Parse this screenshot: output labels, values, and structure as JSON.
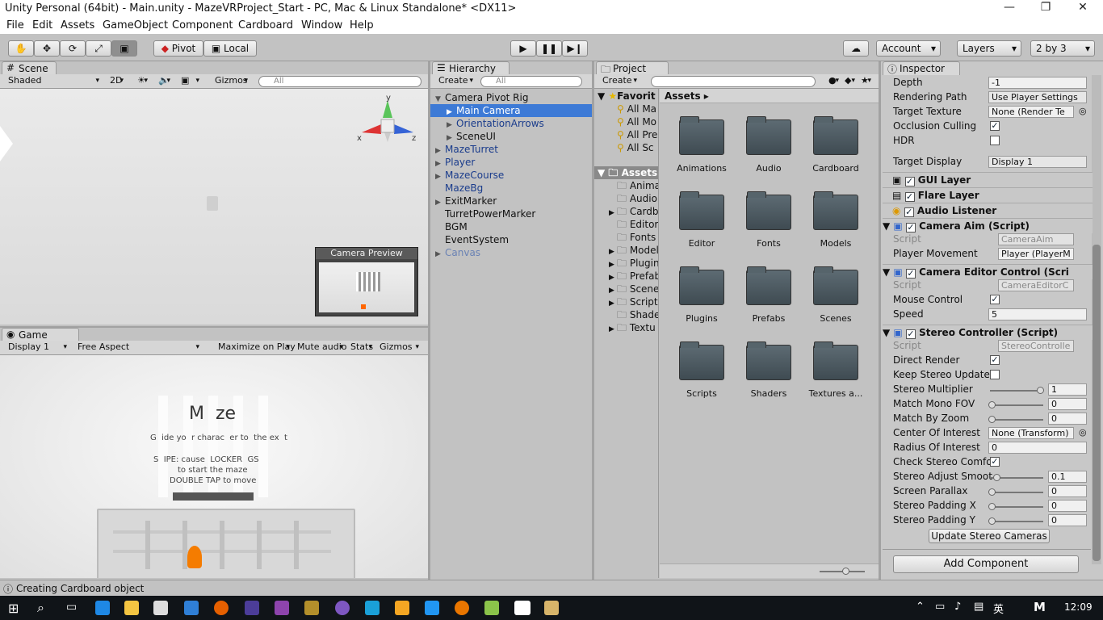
{
  "window": {
    "title": "Unity Personal (64bit) - Main.unity - MazeVRProject_Start - PC, Mac & Linux Standalone* <DX11>",
    "minimize": "—",
    "restore": "❐",
    "close": "✕"
  },
  "menu": [
    "File",
    "Edit",
    "Assets",
    "GameObject",
    "Component",
    "Cardboard",
    "Window",
    "Help"
  ],
  "toolbar": {
    "pivot": "Pivot",
    "local": "Local",
    "account": "Account",
    "layers": "Layers",
    "layout": "2 by 3"
  },
  "scene": {
    "tab": "Scene",
    "shading": "Shaded",
    "mode2d": "2D",
    "gizmos": "Gizmos",
    "search": "All",
    "axis_x": "x",
    "axis_y": "y",
    "axis_z": "z",
    "preview_title": "Camera Preview"
  },
  "game": {
    "tab": "Game",
    "display": "Display 1",
    "aspect": "Free Aspect",
    "maximize": "Maximize on Play",
    "mute": "Mute audio",
    "stats": "Stats",
    "gizmos": "Gizmos",
    "logo": "M  ze",
    "line1": "G  ide yo  r charac  er to  the ex  t",
    "line2": "S  IPE: cause  LOCKER  GS",
    "line3": "to start the maze",
    "line4": "DOUBLE TAP to move"
  },
  "hierarchy": {
    "tab": "Hierarchy",
    "create": "Create",
    "search": "All",
    "items": [
      {
        "label": "Camera Pivot Rig",
        "indent": 0,
        "arrow": "▼",
        "color": "black",
        "selected": false
      },
      {
        "label": "Main Camera",
        "indent": 1,
        "arrow": "▶",
        "color": "white",
        "selected": true
      },
      {
        "label": "OrientationArrows",
        "indent": 1,
        "arrow": "▶",
        "color": "blue",
        "selected": false
      },
      {
        "label": "SceneUI",
        "indent": 1,
        "arrow": "▶",
        "color": "black",
        "selected": false
      },
      {
        "label": "MazeTurret",
        "indent": 0,
        "arrow": "▶",
        "color": "blue",
        "selected": false
      },
      {
        "label": "Player",
        "indent": 0,
        "arrow": "▶",
        "color": "blue",
        "selected": false
      },
      {
        "label": "MazeCourse",
        "indent": 0,
        "arrow": "▶",
        "color": "blue",
        "selected": false
      },
      {
        "label": "MazeBg",
        "indent": 0,
        "arrow": "",
        "color": "blue",
        "selected": false
      },
      {
        "label": "ExitMarker",
        "indent": 0,
        "arrow": "▶",
        "color": "black",
        "selected": false
      },
      {
        "label": "TurretPowerMarker",
        "indent": 0,
        "arrow": "",
        "color": "black",
        "selected": false
      },
      {
        "label": "BGM",
        "indent": 0,
        "arrow": "",
        "color": "black",
        "selected": false
      },
      {
        "label": "EventSystem",
        "indent": 0,
        "arrow": "",
        "color": "black",
        "selected": false
      },
      {
        "label": "Canvas",
        "indent": 0,
        "arrow": "▶",
        "color": "lightblue",
        "selected": false
      }
    ]
  },
  "project": {
    "tab": "Project",
    "create": "Create",
    "breadcrumb": "Assets ▸",
    "favorites_label": "Favorit",
    "favorites": [
      "All Ma",
      "All Mo",
      "All Pre",
      "All Sc"
    ],
    "assets_label": "Assets",
    "tree": [
      {
        "label": "Anima",
        "arrow": ""
      },
      {
        "label": "Audio",
        "arrow": ""
      },
      {
        "label": "Cardb",
        "arrow": "▶"
      },
      {
        "label": "Editor",
        "arrow": ""
      },
      {
        "label": "Fonts",
        "arrow": ""
      },
      {
        "label": "Model",
        "arrow": "▶"
      },
      {
        "label": "Plugin",
        "arrow": "▶"
      },
      {
        "label": "Prefab",
        "arrow": "▶"
      },
      {
        "label": "Scene",
        "arrow": "▶"
      },
      {
        "label": "Script",
        "arrow": "▶"
      },
      {
        "label": "Shade",
        "arrow": ""
      },
      {
        "label": "Textu",
        "arrow": "▶"
      }
    ],
    "folders": [
      "Animations",
      "Audio",
      "Cardboard",
      "Editor",
      "Fonts",
      "Models",
      "Plugins",
      "Prefabs",
      "Scenes",
      "Scripts",
      "Shaders",
      "Textures a..."
    ]
  },
  "inspector": {
    "tab": "Inspector",
    "camera": {
      "depth_label": "Depth",
      "depth": "-1",
      "rendering_label": "Rendering Path",
      "rendering": "Use Player Settings",
      "target_label": "Target Texture",
      "target": "None (Render Te",
      "occlusion_label": "Occlusion Culling",
      "hdr_label": "HDR",
      "display_label": "Target Display",
      "display": "Display 1"
    },
    "components": [
      "GUI Layer",
      "Flare Layer",
      "Audio Listener"
    ],
    "camera_aim": {
      "title": "Camera Aim (Script)",
      "script_label": "Script",
      "script": "CameraAim",
      "pm_label": "Player Movement",
      "pm": "Player (PlayerM"
    },
    "camera_editor": {
      "title": "Camera Editor Control (Scri",
      "script_label": "Script",
      "script": "CameraEditorC",
      "mouse_label": "Mouse Control",
      "speed_label": "Speed",
      "speed": "5"
    },
    "stereo": {
      "title": "Stereo Controller (Script)",
      "script_label": "Script",
      "script": "StereoControlle",
      "direct_label": "Direct Render",
      "keep_label": "Keep Stereo Update",
      "multiplier_label": "Stereo Multiplier",
      "multiplier": "1",
      "mono_label": "Match Mono FOV",
      "mono": "0",
      "zoom_label": "Match By Zoom",
      "zoom": "0",
      "coi_label": "Center Of Interest",
      "coi": "None (Transform)",
      "roi_label": "Radius Of Interest",
      "roi": "0",
      "check_label": "Check Stereo Comfo",
      "smooth_label": "Stereo Adjust Smoot",
      "smooth": "0.1",
      "parallax_label": "Screen Parallax",
      "parallax": "0",
      "padx_label": "Stereo Padding X",
      "padx": "0",
      "pady_label": "Stereo Padding Y",
      "pady": "0",
      "update_button": "Update Stereo Cameras"
    },
    "add_component": "Add Component"
  },
  "status": {
    "text": "Creating Cardboard object"
  },
  "taskbar": {
    "time": "12:09",
    "ime": "英",
    "ime2": "M"
  }
}
